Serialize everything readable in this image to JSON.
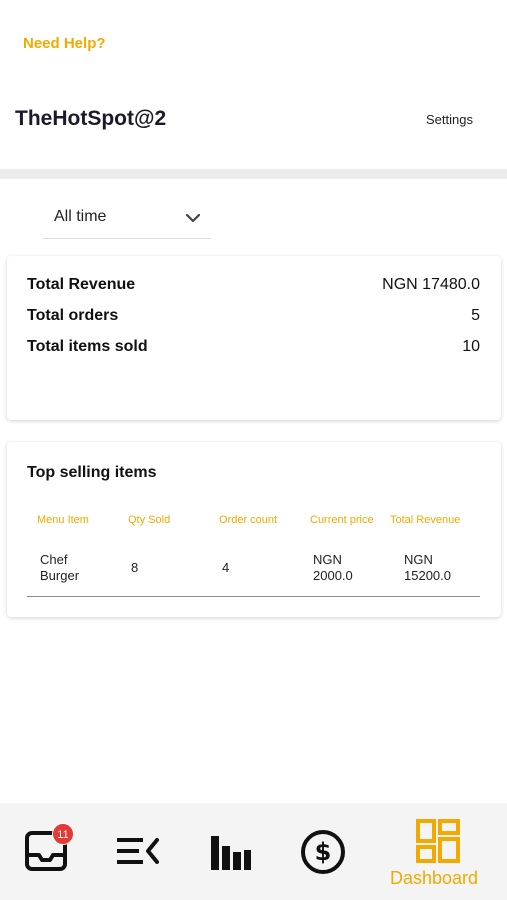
{
  "header": {
    "help_label": "Need Help?",
    "title": "TheHotSpot@2",
    "settings_label": "Settings"
  },
  "filter": {
    "selected": "All time",
    "icon": "chevron-down-icon"
  },
  "stats": [
    {
      "label": "Total Revenue",
      "value": "NGN 17480.0"
    },
    {
      "label": "Total orders",
      "value": "5"
    },
    {
      "label": "Total items sold",
      "value": "10"
    }
  ],
  "top_selling": {
    "title": "Top selling items",
    "columns": [
      "Menu Item",
      "Qty Sold",
      "Order count",
      "Current price",
      "Total Revenue"
    ],
    "rows": [
      {
        "item_line1": "Chef",
        "item_line2": "Burger",
        "qty": "8",
        "orders": "4",
        "price_line1": "NGN",
        "price_line2": "2000.0",
        "revenue_line1": "NGN",
        "revenue_line2": "15200.0"
      }
    ]
  },
  "tabbar": {
    "inbox_badge": "11",
    "active_label": "Dashboard",
    "icons": [
      "inbox-icon",
      "menu-list-icon",
      "bar-chart-icon",
      "dollar-icon",
      "dashboard-icon"
    ]
  },
  "colors": {
    "accent": "#f2a900",
    "badge": "#e53935",
    "icon": "#111111"
  }
}
